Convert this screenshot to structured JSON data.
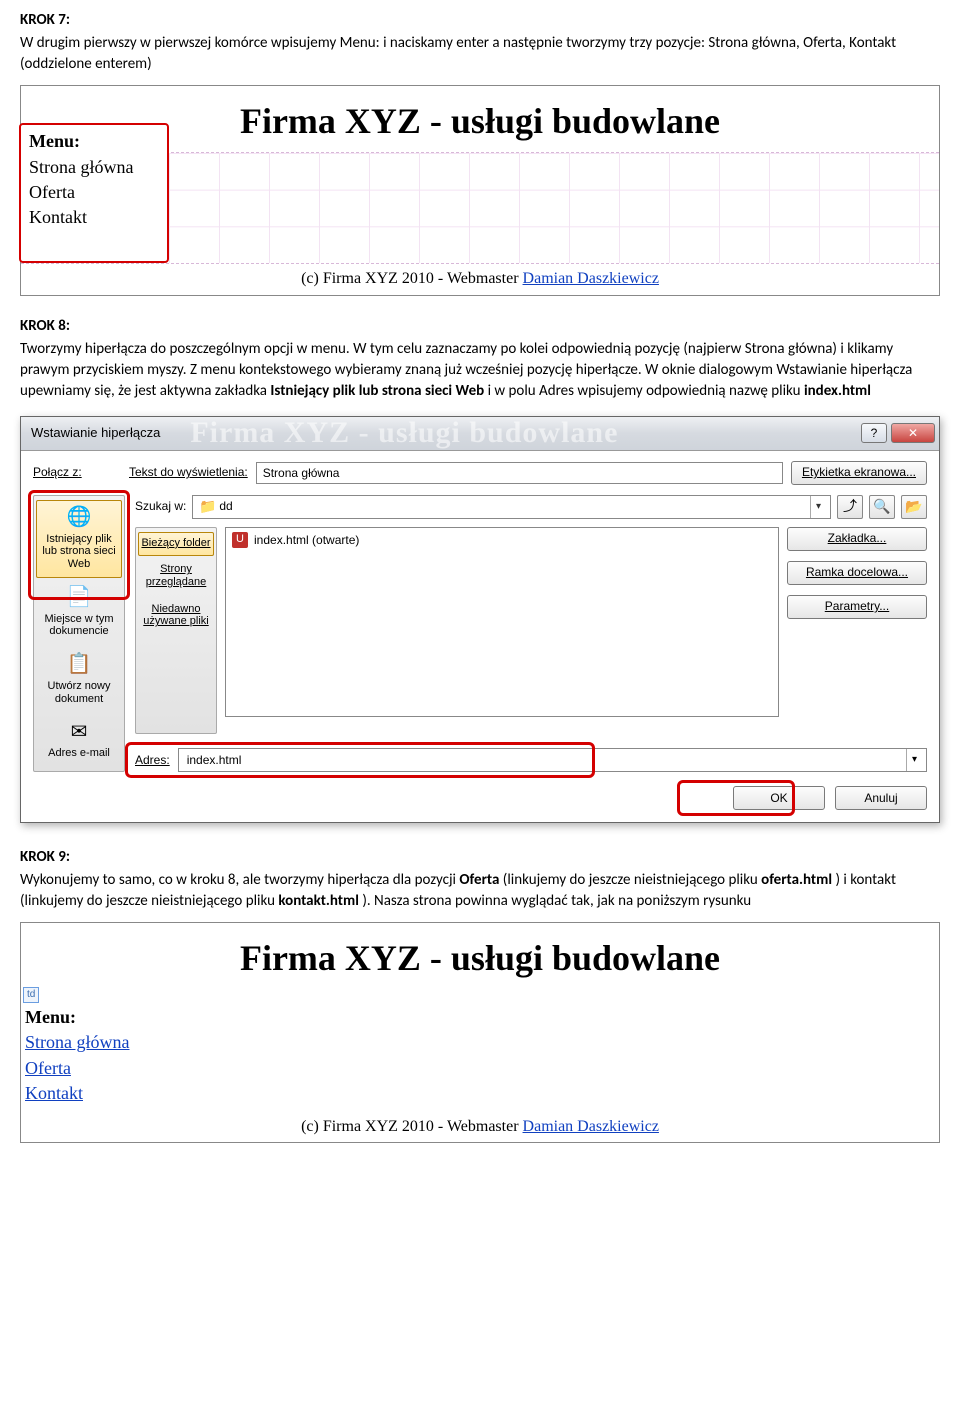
{
  "krok7": {
    "heading": "KROK 7:",
    "text_pre": "W drugim pierwszy w pierwszej komórce wpisujemy  Menu: i naciskamy enter a następnie tworzymy trzy pozycje: Strona główna, Oferta, Kontakt (oddzielone enterem)"
  },
  "ss1": {
    "header": "Firma XYZ - usługi budowlane",
    "menu_title": "Menu:",
    "menu_items": [
      "Strona główna",
      "Oferta",
      "Kontakt"
    ],
    "footer_text": "(c) Firma XYZ 2010 - Webmaster ",
    "footer_link": "Damian Daszkiewicz"
  },
  "krok8": {
    "heading": "KROK 8:",
    "text_1": "Tworzymy hiperłącza do poszczególnym opcji w menu. W tym celu zaznaczamy po kolei odpowiednią pozycję (najpierw Strona główna) i klikamy prawym przyciskiem myszy. Z menu kontekstowego wybieramy znaną już wcześniej pozycję hiperłącze. W oknie dialogowym Wstawianie hiperłącza upewniamy się, że jest aktywna zakładka ",
    "bold_1": "Istniejący plik lub strona sieci Web",
    "text_2": " i w polu Adres wpisujemy odpowiednią nazwę pliku ",
    "bold_2": "index.html"
  },
  "dialog": {
    "title": "Wstawianie hiperłącza",
    "ghost_title": "Firma XYZ - usługi budowlane",
    "link_label": "Połącz z:",
    "display_label": "Tekst do wyświetlenia:",
    "display_value": "Strona główna",
    "screen_tip": "Etykietka ekranowa...",
    "search_label": "Szukaj w:",
    "search_folder": "dd",
    "leftbar": [
      {
        "label": "Istniejący plik lub strona sieci Web",
        "icon": "🌐",
        "selected": true
      },
      {
        "label": "Miejsce w tym dokumencie",
        "icon": "📄",
        "selected": false
      },
      {
        "label": "Utwórz nowy dokument",
        "icon": "📋",
        "selected": false
      },
      {
        "label": "Adres e-mail",
        "icon": "✉",
        "selected": false
      }
    ],
    "navcol": [
      {
        "label": "Bieżący folder",
        "selected": true
      },
      {
        "label": "Strony przeglądane",
        "selected": false
      },
      {
        "label": "Niedawno używane pliki",
        "selected": false
      }
    ],
    "file_item": "index.html (otwarte)",
    "btn_bookmark": "Zakładka...",
    "btn_frame": "Ramka docelowa...",
    "btn_params": "Parametry...",
    "addr_label": "Adres:",
    "addr_value": "index.html",
    "btn_ok": "OK",
    "btn_cancel": "Anuluj"
  },
  "krok9": {
    "heading": "KROK 9:",
    "text_1": "Wykonujemy to samo, co w kroku 8, ale tworzymy hiperłącza dla pozycji ",
    "bold_1": "Oferta",
    "text_2": " (linkujemy do jeszcze nieistniejącego pliku ",
    "bold_2": "oferta.html",
    "text_3": ") i kontakt (linkujemy do jeszcze nieistniejącego pliku ",
    "bold_3": "kontakt.html",
    "text_4": "). Nasza strona powinna wyglądać tak, jak na poniższym rysunku"
  },
  "ss3": {
    "header": "Firma XYZ - usługi budowlane",
    "td_badge": "td",
    "menu_title": "Menu:",
    "menu_items": [
      "Strona główna",
      "Oferta",
      "Kontakt"
    ],
    "footer_text": "(c) Firma XYZ 2010 - Webmaster ",
    "footer_link": "Damian Daszkiewicz"
  }
}
